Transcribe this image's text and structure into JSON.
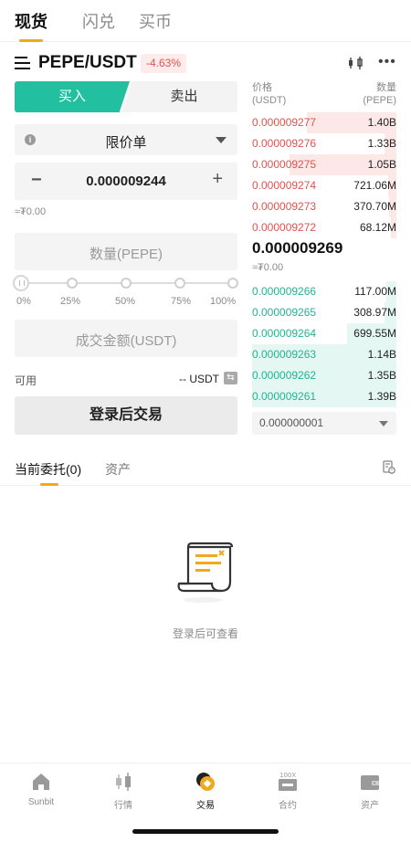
{
  "top_tabs": {
    "spot": "现货",
    "flash": "闪兑",
    "buy": "买币"
  },
  "pair": {
    "name": "PEPE/USDT",
    "change": "-4.63%"
  },
  "trade": {
    "buy_label": "买入",
    "sell_label": "卖出",
    "order_type": "限价单",
    "price": "0.000009244",
    "price_approx": "≈₮0.00",
    "qty_placeholder": "数量(PEPE)",
    "slider_labels": [
      "0%",
      "25%",
      "50%",
      "75%",
      "100%"
    ],
    "amount_placeholder": "成交金额(USDT)",
    "available_label": "可用",
    "available_value": "-- USDT",
    "login_button": "登录后交易"
  },
  "order_book": {
    "price_header": "价格",
    "price_unit": "(USDT)",
    "qty_header": "数量",
    "qty_unit": "(PEPE)",
    "asks": [
      {
        "price": "0.000009277",
        "qty": "1.40B",
        "depth": 0.62
      },
      {
        "price": "0.000009276",
        "qty": "1.33B",
        "depth": 0.08
      },
      {
        "price": "0.000009275",
        "qty": "1.05B",
        "depth": 0.74
      },
      {
        "price": "0.000009274",
        "qty": "721.06M",
        "depth": 0.06
      },
      {
        "price": "0.000009273",
        "qty": "370.70M",
        "depth": 0.05
      },
      {
        "price": "0.000009272",
        "qty": "68.12M",
        "depth": 0.04
      }
    ],
    "last_price": "0.000009269",
    "last_approx": "≈₮0.00",
    "bids": [
      {
        "price": "0.000009266",
        "qty": "117.00M",
        "depth": 0.07
      },
      {
        "price": "0.000009265",
        "qty": "308.97M",
        "depth": 0.08
      },
      {
        "price": "0.000009264",
        "qty": "699.55M",
        "depth": 0.34
      },
      {
        "price": "0.000009263",
        "qty": "1.14B",
        "depth": 1.0
      },
      {
        "price": "0.000009262",
        "qty": "1.35B",
        "depth": 1.0
      },
      {
        "price": "0.000009261",
        "qty": "1.39B",
        "depth": 1.0
      }
    ],
    "precision": "0.000000001"
  },
  "orders": {
    "tab_current": "当前委托(0)",
    "tab_assets": "资产",
    "empty_text": "登录后可查看"
  },
  "bottom_nav": [
    {
      "label": "Sunbit",
      "icon": "home-icon"
    },
    {
      "label": "行情",
      "icon": "candlestick-icon"
    },
    {
      "label": "交易",
      "icon": "trade-icon"
    },
    {
      "label": "合约",
      "icon": "contract-icon"
    },
    {
      "label": "资产",
      "icon": "wallet-icon"
    }
  ],
  "colors": {
    "accent": "#f0a81d",
    "buy": "#22c0a0",
    "sell": "#e0524e"
  }
}
